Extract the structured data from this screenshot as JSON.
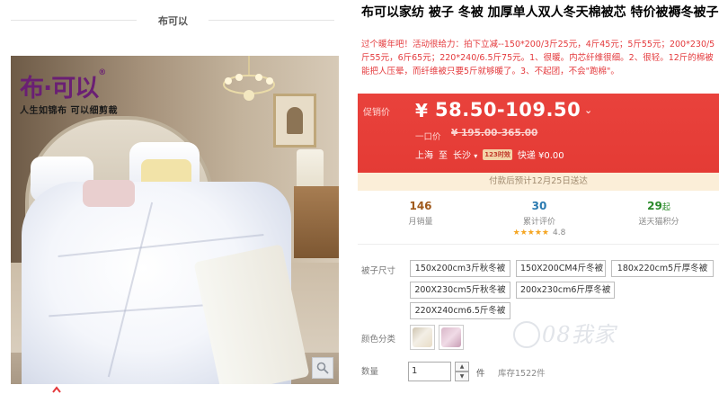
{
  "shop": {
    "name": "布可以"
  },
  "image": {
    "brand_logo": "布·可以",
    "brand_slogan": "人生如锦布 可以细剪裁"
  },
  "product": {
    "title": "布可以家纺 被子 冬被 加厚单人双人冬天棉被芯 特价被褥冬被子",
    "subtitle": "过个暖年吧！活动很给力：拍下立减--150*200/3斤25元，4斤45元；5斤55元；200*230/5斤55元，6斤65元；220*240/6.5斤75元。1、很暖。内芯纤维很细。2、很轻。12斤的棉被能把人压晕，而纤维被只要5斤就够暖了。3、不起团，不会\"跑棉\"。"
  },
  "price": {
    "label": "促销价",
    "currency": "¥",
    "value": "58.50-109.50",
    "caret": "⌄",
    "list_label": "一口价",
    "list_price": "¥ 195.00-365.00",
    "ship_from": "上海",
    "ship_to_word": "至",
    "ship_to": "长沙",
    "ship_badge": "123时效",
    "shipping": "快递 ¥0.00"
  },
  "notice": "付款后预计12月25日送达",
  "stats": {
    "monthly_sales": {
      "value": "146",
      "label": "月销量"
    },
    "reviews": {
      "value": "30",
      "label": "累计评价",
      "stars": "★★★★★",
      "score": "4.8"
    },
    "points": {
      "value": "29",
      "unit": "起",
      "label": "送天猫积分"
    }
  },
  "colors": {
    "price_bg": "#e43b35",
    "accent": "#e4393c",
    "notice_bg": "#fbeed8",
    "points": "#2a8a2a",
    "reviews": "#2a7ab0",
    "sales": "#a05a1c"
  },
  "options": {
    "size_label": "被子尺寸",
    "sizes": [
      "150x200cm3斤秋冬被",
      "150X200CM4斤冬被",
      "180x220cm5斤厚冬被",
      "200X230cm5斤秋冬被",
      "200x230cm6斤厚冬被",
      "220X240cm6.5斤冬被"
    ],
    "color_label": "颜色分类",
    "quantity_label": "数量",
    "quantity_value": "1",
    "quantity_unit": "件",
    "stock": "库存1522件"
  },
  "watermark": "08我家"
}
